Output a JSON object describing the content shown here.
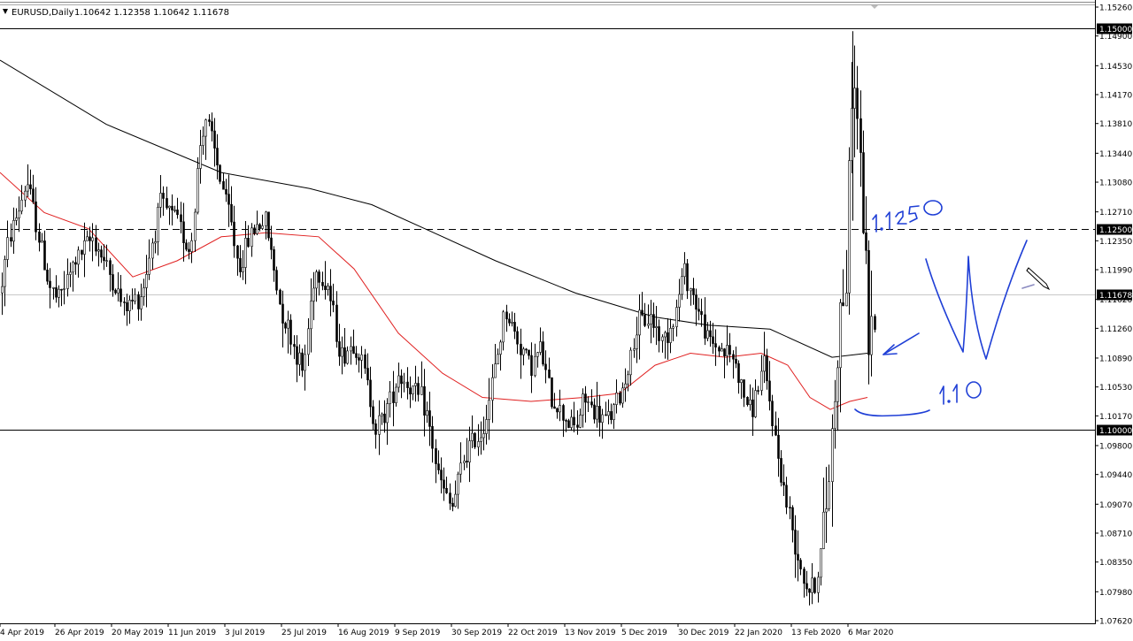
{
  "header": {
    "symbol": "EURUSD,Daily",
    "ohlc": "1.10642 1.12358 1.10642 1.11678"
  },
  "colors": {
    "background": "#ffffff",
    "candles": "#000000",
    "ma_slow": "#000000",
    "ma_fast": "#e02020",
    "annotation": "#1f3fd6",
    "label_bg": "#000000",
    "label_text": "#ffffff",
    "price_line": "#c8c8c8"
  },
  "chart_data": {
    "type": "candlestick",
    "symbol": "EURUSD",
    "timeframe": "Daily",
    "y_range": [
      1.0762,
      1.1526
    ],
    "y_ticks": [
      "1.15260",
      "1.14900",
      "1.14530",
      "1.14170",
      "1.13810",
      "1.13440",
      "1.13080",
      "1.12710",
      "1.12350",
      "1.11990",
      "1.11620",
      "1.11260",
      "1.10890",
      "1.10530",
      "1.10170",
      "1.09800",
      "1.09440",
      "1.09070",
      "1.08710",
      "1.08350",
      "1.07980",
      "1.07620"
    ],
    "x_labels": [
      "4 Apr 2019",
      "26 Apr 2019",
      "20 May 2019",
      "11 Jun 2019",
      "3 Jul 2019",
      "25 Jul 2019",
      "16 Aug 2019",
      "9 Sep 2019",
      "30 Sep 2019",
      "22 Oct 2019",
      "13 Nov 2019",
      "5 Dec 2019",
      "30 Dec 2019",
      "22 Jan 2020",
      "13 Feb 2020",
      "6 Mar 2020"
    ],
    "price_path": [
      [
        0,
        1.117
      ],
      [
        10,
        1.124
      ],
      [
        20,
        1.127
      ],
      [
        30,
        1.131
      ],
      [
        40,
        1.126
      ],
      [
        55,
        1.118
      ],
      [
        65,
        1.116
      ],
      [
        85,
        1.121
      ],
      [
        105,
        1.124
      ],
      [
        125,
        1.119
      ],
      [
        140,
        1.115
      ],
      [
        160,
        1.117
      ],
      [
        180,
        1.128
      ],
      [
        200,
        1.126
      ],
      [
        215,
        1.122
      ],
      [
        225,
        1.135
      ],
      [
        232,
        1.139
      ],
      [
        245,
        1.133
      ],
      [
        260,
        1.126
      ],
      [
        270,
        1.12
      ],
      [
        285,
        1.125
      ],
      [
        300,
        1.126
      ],
      [
        315,
        1.116
      ],
      [
        330,
        1.111
      ],
      [
        342,
        1.107
      ],
      [
        355,
        1.12
      ],
      [
        370,
        1.118
      ],
      [
        385,
        1.109
      ],
      [
        400,
        1.111
      ],
      [
        412,
        1.107
      ],
      [
        425,
        1.1
      ],
      [
        438,
        1.103
      ],
      [
        450,
        1.107
      ],
      [
        465,
        1.105
      ],
      [
        480,
        1.103
      ],
      [
        495,
        1.094
      ],
      [
        510,
        1.09
      ],
      [
        525,
        1.097
      ],
      [
        545,
        1.1
      ],
      [
        560,
        1.108
      ],
      [
        570,
        1.115
      ],
      [
        585,
        1.111
      ],
      [
        600,
        1.108
      ],
      [
        610,
        1.11
      ],
      [
        622,
        1.104
      ],
      [
        635,
        1.102
      ],
      [
        650,
        1.1
      ],
      [
        660,
        1.104
      ],
      [
        672,
        1.102
      ],
      [
        685,
        1.101
      ],
      [
        700,
        1.104
      ],
      [
        710,
        1.108
      ],
      [
        720,
        1.113
      ],
      [
        735,
        1.114
      ],
      [
        748,
        1.111
      ],
      [
        762,
        1.114
      ],
      [
        772,
        1.12
      ],
      [
        785,
        1.116
      ],
      [
        800,
        1.111
      ],
      [
        815,
        1.11
      ],
      [
        828,
        1.109
      ],
      [
        838,
        1.105
      ],
      [
        848,
        1.102
      ],
      [
        862,
        1.108
      ],
      [
        870,
        1.103
      ],
      [
        878,
        1.097
      ],
      [
        888,
        1.091
      ],
      [
        900,
        1.085
      ],
      [
        912,
        1.08
      ],
      [
        922,
        1.081
      ],
      [
        932,
        1.089
      ],
      [
        940,
        1.1
      ],
      [
        948,
        1.114
      ],
      [
        956,
        1.119
      ],
      [
        962,
        1.143
      ],
      [
        968,
        1.14
      ],
      [
        975,
        1.126
      ],
      [
        982,
        1.11
      ],
      [
        990,
        1.1168
      ]
    ],
    "moving_average_slow": [
      [
        0,
        1.146
      ],
      [
        120,
        1.138
      ],
      [
        250,
        1.132
      ],
      [
        350,
        1.13
      ],
      [
        420,
        1.128
      ],
      [
        480,
        1.125
      ],
      [
        560,
        1.121
      ],
      [
        650,
        1.117
      ],
      [
        740,
        1.114
      ],
      [
        800,
        1.113
      ],
      [
        870,
        1.1125
      ],
      [
        940,
        1.109
      ],
      [
        980,
        1.1095
      ]
    ],
    "moving_average_fast": [
      [
        0,
        1.132
      ],
      [
        50,
        1.127
      ],
      [
        100,
        1.125
      ],
      [
        150,
        1.119
      ],
      [
        200,
        1.121
      ],
      [
        250,
        1.124
      ],
      [
        300,
        1.1245
      ],
      [
        360,
        1.124
      ],
      [
        400,
        1.12
      ],
      [
        450,
        1.112
      ],
      [
        500,
        1.107
      ],
      [
        545,
        1.104
      ],
      [
        600,
        1.1035
      ],
      [
        660,
        1.104
      ],
      [
        700,
        1.1045
      ],
      [
        740,
        1.108
      ],
      [
        780,
        1.1095
      ],
      [
        820,
        1.109
      ],
      [
        860,
        1.1095
      ],
      [
        890,
        1.108
      ],
      [
        915,
        1.104
      ],
      [
        938,
        1.1025
      ],
      [
        960,
        1.1035
      ],
      [
        980,
        1.104
      ]
    ],
    "horizontal_levels": [
      {
        "price": 1.15,
        "label": "1.15000",
        "style": "solid"
      },
      {
        "price": 1.125,
        "label": "1.12500",
        "style": "dashed"
      },
      {
        "price": 1.11678,
        "label": "1.11678",
        "style": "current"
      },
      {
        "price": 1.1,
        "label": "1.10000",
        "style": "solid"
      }
    ],
    "annotations": [
      "1.1250",
      "1.10"
    ]
  }
}
